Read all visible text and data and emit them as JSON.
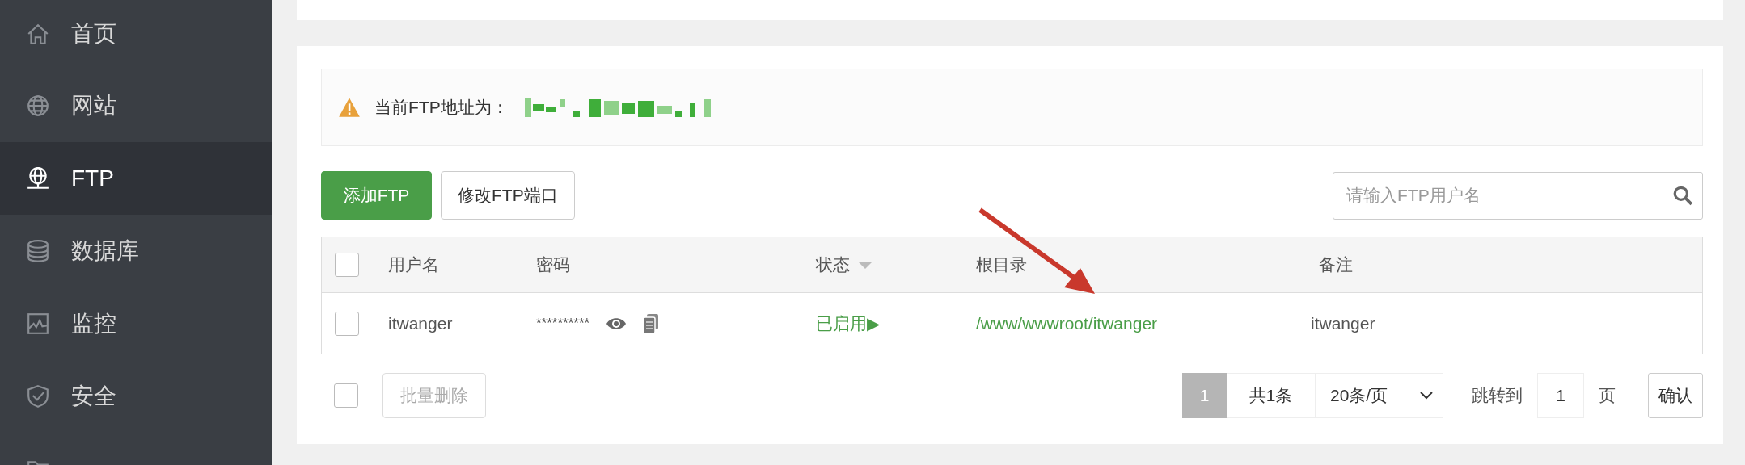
{
  "sidebar": {
    "items": [
      {
        "label": "首页",
        "selected": false
      },
      {
        "label": "网站",
        "selected": false
      },
      {
        "label": "FTP",
        "selected": true
      },
      {
        "label": "数据库",
        "selected": false
      },
      {
        "label": "监控",
        "selected": false
      },
      {
        "label": "安全",
        "selected": false
      },
      {
        "selected": false
      }
    ]
  },
  "alert": {
    "text": "当前FTP地址为："
  },
  "toolbar": {
    "buttons": [
      {
        "label": "添加FTP",
        "kind": "primary"
      },
      {
        "label": "修改FTP端口",
        "kind": "default"
      }
    ],
    "search": {
      "placeholder": "请输入FTP用户名"
    }
  },
  "table": {
    "select_all": {
      "checked": false
    },
    "columns": [
      {
        "label": "用户名",
        "sortable": false
      },
      {
        "label": "密码",
        "sortable": false
      },
      {
        "label": "状态",
        "sortable": true
      },
      {
        "label": "根目录",
        "sortable": false
      },
      {
        "label": "备注",
        "sortable": false
      }
    ],
    "rows": [
      {
        "selected": false,
        "username": "itwanger",
        "password": "**********",
        "status": "已启用▶",
        "root": "/www/wwwroot/itwanger",
        "note": "itwanger"
      }
    ]
  },
  "footer": {
    "select_all": {
      "checked": false
    },
    "batch_button": {
      "label": "批量删除",
      "disabled": true
    },
    "pagination": {
      "pages": [
        {
          "label": "1",
          "selected": true
        }
      ],
      "total": "共1条",
      "page_size": "20条/页",
      "jump_label": "跳转到",
      "jump_value": "1",
      "page_unit": "页",
      "confirm": "确认"
    }
  }
}
